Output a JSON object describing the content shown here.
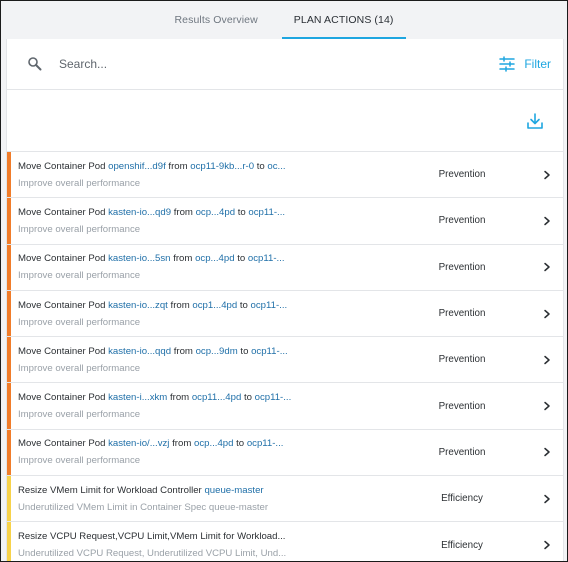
{
  "tabs": [
    {
      "label": "Results Overview",
      "active": false
    },
    {
      "label": "PLAN ACTIONS (14)",
      "active": true
    }
  ],
  "search": {
    "placeholder": "Search...",
    "value": ""
  },
  "filter": {
    "label": "Filter"
  },
  "colors": {
    "accent": "#1ea6e0",
    "link": "#1f6fa8",
    "prevention": "#f07c2a",
    "efficiency": "#f7d24a"
  },
  "icons": {
    "search": "search-icon",
    "filter": "filter-icon",
    "download": "download-icon",
    "chevron": "chevron-right-icon"
  },
  "actions": [
    {
      "prefix": "Move Container Pod ",
      "entity": "openshif...d9f",
      "from_word": " from ",
      "source": "ocp11-9kb...r-0",
      "to_word": " to ",
      "dest": "oc...",
      "subtitle": "Improve overall performance",
      "category": "Prevention",
      "color": "#f07c2a"
    },
    {
      "prefix": "Move Container Pod ",
      "entity": "kasten-io...qd9",
      "from_word": " from ",
      "source": "ocp...4pd",
      "to_word": " to ",
      "dest": "ocp11-...",
      "subtitle": "Improve overall performance",
      "category": "Prevention",
      "color": "#f07c2a"
    },
    {
      "prefix": "Move Container Pod ",
      "entity": "kasten-io...5sn",
      "from_word": " from ",
      "source": "ocp...4pd",
      "to_word": " to ",
      "dest": "ocp11-...",
      "subtitle": "Improve overall performance",
      "category": "Prevention",
      "color": "#f07c2a"
    },
    {
      "prefix": "Move Container Pod ",
      "entity": "kasten-io...zqt",
      "from_word": " from ",
      "source": "ocp1...4pd",
      "to_word": " to ",
      "dest": "ocp11-...",
      "subtitle": "Improve overall performance",
      "category": "Prevention",
      "color": "#f07c2a"
    },
    {
      "prefix": "Move Container Pod ",
      "entity": "kasten-io...qqd",
      "from_word": " from ",
      "source": "ocp...9dm",
      "to_word": " to ",
      "dest": "ocp11-...",
      "subtitle": "Improve overall performance",
      "category": "Prevention",
      "color": "#f07c2a"
    },
    {
      "prefix": "Move Container Pod ",
      "entity": "kasten-i...xkm",
      "from_word": " from ",
      "source": "ocp11...4pd",
      "to_word": " to ",
      "dest": "ocp11-...",
      "subtitle": "Improve overall performance",
      "category": "Prevention",
      "color": "#f07c2a"
    },
    {
      "prefix": "Move Container Pod ",
      "entity": "kasten-io/...vzj",
      "from_word": " from ",
      "source": "ocp...4pd",
      "to_word": " to ",
      "dest": "ocp11-...",
      "subtitle": "Improve overall performance",
      "category": "Prevention",
      "color": "#f07c2a"
    },
    {
      "prefix": "Resize VMem Limit for Workload Controller ",
      "entity": "queue-master",
      "from_word": "",
      "source": "",
      "to_word": "",
      "dest": "",
      "subtitle": "Underutilized VMem Limit in Container Spec queue-master",
      "category": "Efficiency",
      "color": "#f7d24a"
    },
    {
      "prefix": "Resize VCPU Request,VCPU Limit,VMem Limit for Workload...",
      "entity": "",
      "from_word": "",
      "source": "",
      "to_word": "",
      "dest": "",
      "subtitle": "Underutilized VCPU Request, Underutilized VCPU Limit, Und...",
      "category": "Efficiency",
      "color": "#f7d24a"
    }
  ]
}
